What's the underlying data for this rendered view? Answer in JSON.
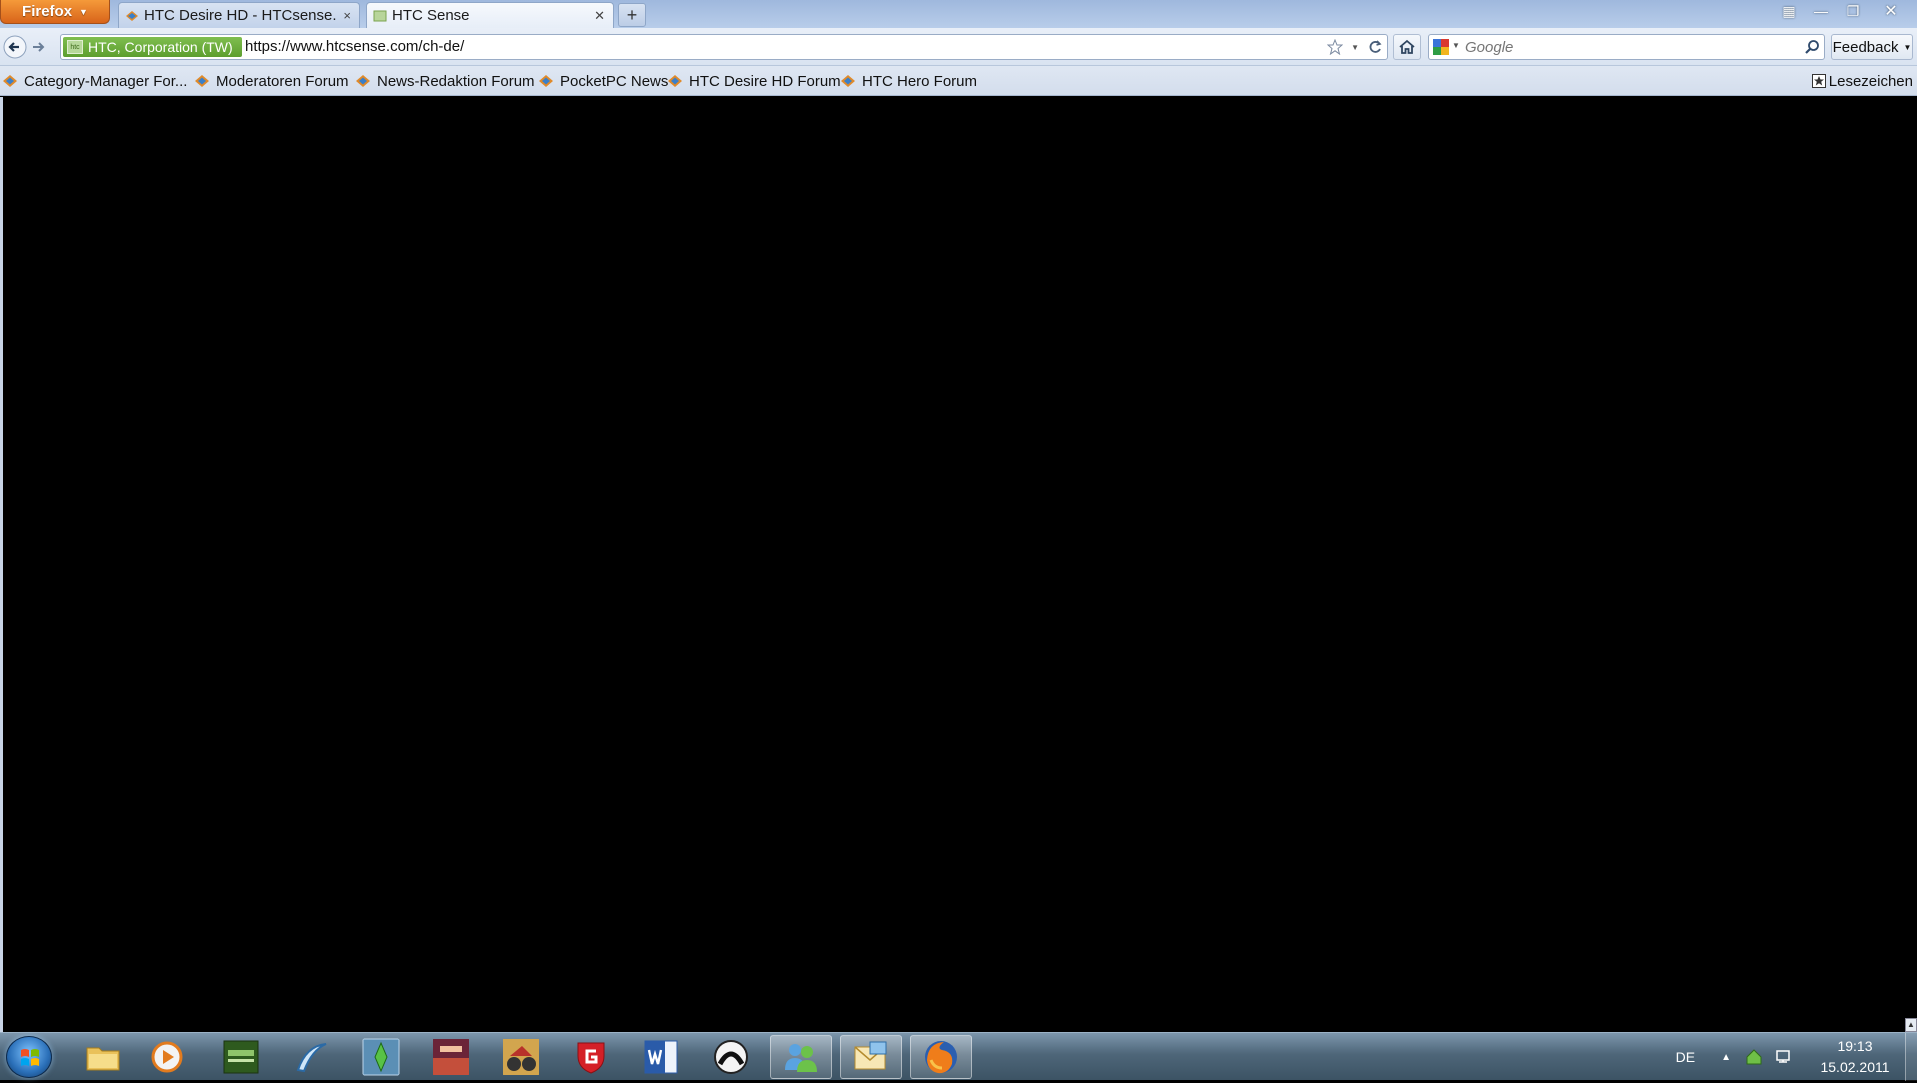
{
  "browser": {
    "menu_button": "Firefox",
    "tabs": [
      {
        "label": "HTC Desire HD - HTCsense.c...",
        "active": false
      },
      {
        "label": "HTC Sense",
        "active": true
      }
    ],
    "new_tab": "+",
    "window_controls": {
      "minimize": "—",
      "maximize": "❐",
      "close": "✕"
    }
  },
  "navbar": {
    "identity_label": "HTC, Corporation (TW)",
    "identity_icon_text": "htc",
    "url": "https://www.htcsense.com/ch-de/",
    "search_placeholder": "Google",
    "feedback_label": "Feedback"
  },
  "bookmarks": {
    "items": [
      "Category-Manager For...",
      "Moderatoren Forum",
      "News-Redaktion Forum",
      "PocketPC News",
      "HTC Desire HD Forum",
      "HTC Hero Forum"
    ],
    "menu_label": "Lesezeichen"
  },
  "taskbar": {
    "language": "DE",
    "time": "19:13",
    "date": "15.02.2011",
    "apps": [
      "explorer-icon",
      "media-player-icon",
      "game-icon",
      "boomerang-icon",
      "sims-icon",
      "game2-icon",
      "game3-icon",
      "gdata-shield-icon",
      "word-icon",
      "app-circle-icon",
      "messenger-icon",
      "mail-icon",
      "firefox-icon"
    ]
  },
  "colors": {
    "content_bg": "#000000",
    "firefox_orange": "#e57a25",
    "identity_green": "#6aaa3a"
  }
}
